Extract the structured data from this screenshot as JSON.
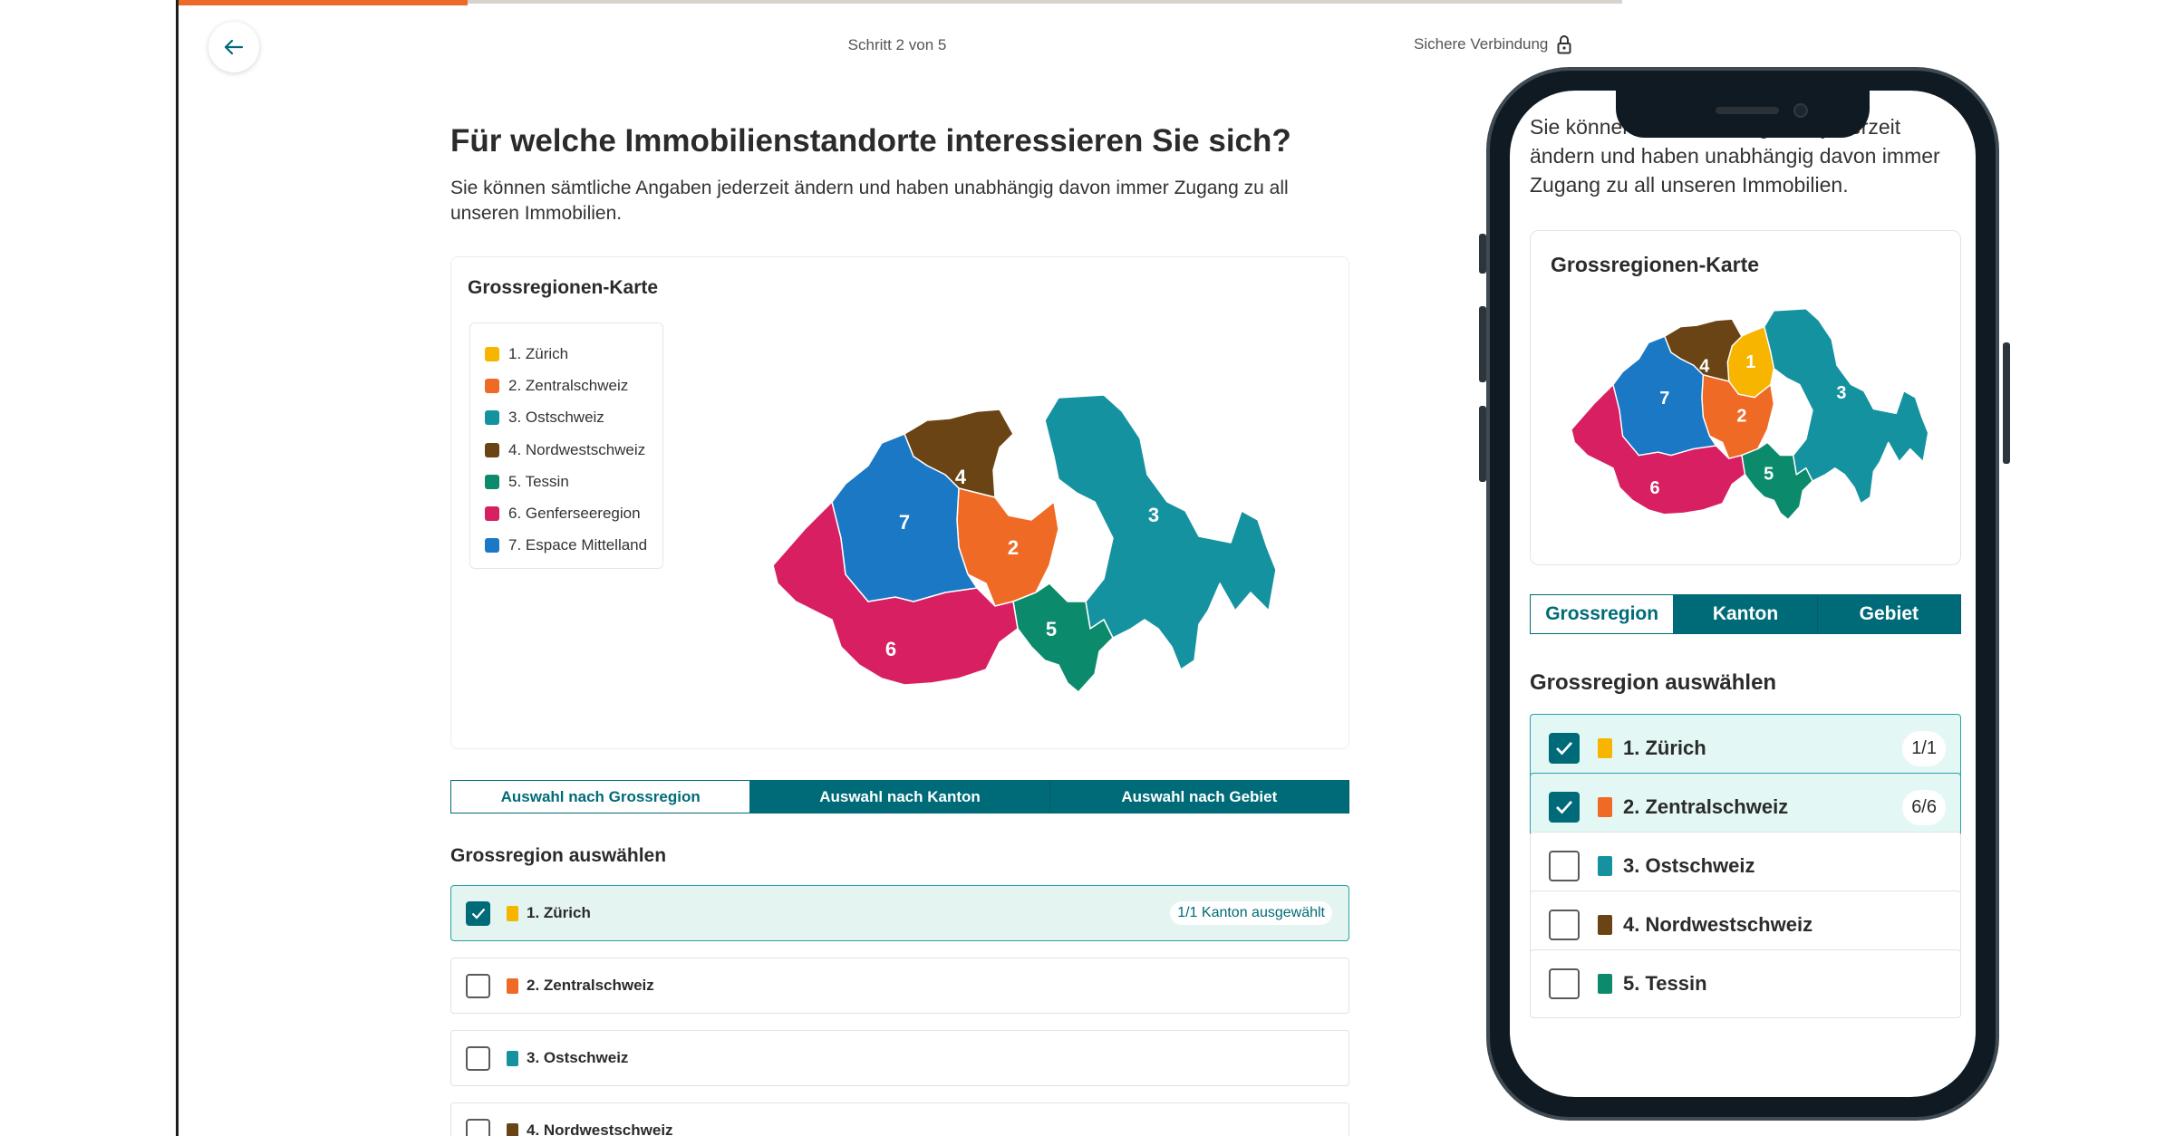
{
  "colors": {
    "accent": "#006b78",
    "progress": "#ec6a29",
    "zurich": "#f7b500",
    "zentralschweiz": "#ef6a25",
    "ostschweiz": "#1592a0",
    "nordwestschweiz": "#6a4414",
    "tessin": "#0b8a6c",
    "genferseeregion": "#d81f62",
    "espace_mittelland": "#1a78c4"
  },
  "progress_fraction": 0.2,
  "header": {
    "back_icon": "arrow-left-icon",
    "step_label": "Schritt 2 von 5",
    "secure_label": "Sichere Verbindung",
    "secure_icon": "lock-icon"
  },
  "page": {
    "title": "Für welche Immobilienstandorte interessieren Sie sich?",
    "intro": "Sie können sämtliche Angaben jederzeit ändern und haben unabhängig davon immer Zugang zu all unseren Immobilien."
  },
  "map": {
    "title": "Grossregionen-Karte",
    "legend": [
      {
        "label": "1. Zürich",
        "color": "#f7b500"
      },
      {
        "label": "2. Zentralschweiz",
        "color": "#ef6a25"
      },
      {
        "label": "3. Ostschweiz",
        "color": "#1592a0"
      },
      {
        "label": "4. Nordwestschweiz",
        "color": "#6a4414"
      },
      {
        "label": "5. Tessin",
        "color": "#0b8a6c"
      },
      {
        "label": "6. Genferseeregion",
        "color": "#d81f62"
      },
      {
        "label": "7. Espace Mittelland",
        "color": "#1a78c4"
      }
    ],
    "region_numbers": [
      "1",
      "2",
      "3",
      "4",
      "5",
      "6",
      "7"
    ]
  },
  "tabs": [
    "Auswahl nach Grossregion",
    "Auswahl nach Kanton",
    "Auswahl nach Gebiet"
  ],
  "section_title": "Grossregion auswählen",
  "options": [
    {
      "label": "1. Zürich",
      "color": "#f7b500",
      "checked": true,
      "badge": "1/1 Kanton ausgewählt"
    },
    {
      "label": "2. Zentralschweiz",
      "color": "#ef6a25",
      "checked": false,
      "badge": ""
    },
    {
      "label": "3. Ostschweiz",
      "color": "#1592a0",
      "checked": false,
      "badge": ""
    },
    {
      "label": "4. Nordwestschweiz",
      "color": "#6a4414",
      "checked": false,
      "badge": ""
    }
  ],
  "phone": {
    "intro": "Sie können sämtliche Angaben jederzeit ändern und haben unabhängig davon immer Zugang zu all unseren Immobilien.",
    "map_title": "Grossregionen-Karte",
    "tabs": [
      "Grossregion",
      "Kanton",
      "Gebiet"
    ],
    "section_title": "Grossregion auswählen",
    "options": [
      {
        "label": "1. Zürich",
        "color": "#f7b500",
        "checked": true,
        "badge": "1/1"
      },
      {
        "label": "2. Zentralschweiz",
        "color": "#ef6a25",
        "checked": true,
        "badge": "6/6"
      },
      {
        "label": "3. Ostschweiz",
        "color": "#1592a0",
        "checked": false,
        "badge": ""
      },
      {
        "label": "4. Nordwestschweiz",
        "color": "#6a4414",
        "checked": false,
        "badge": ""
      },
      {
        "label": "5. Tessin",
        "color": "#0b8a6c",
        "checked": false,
        "badge": ""
      }
    ]
  }
}
